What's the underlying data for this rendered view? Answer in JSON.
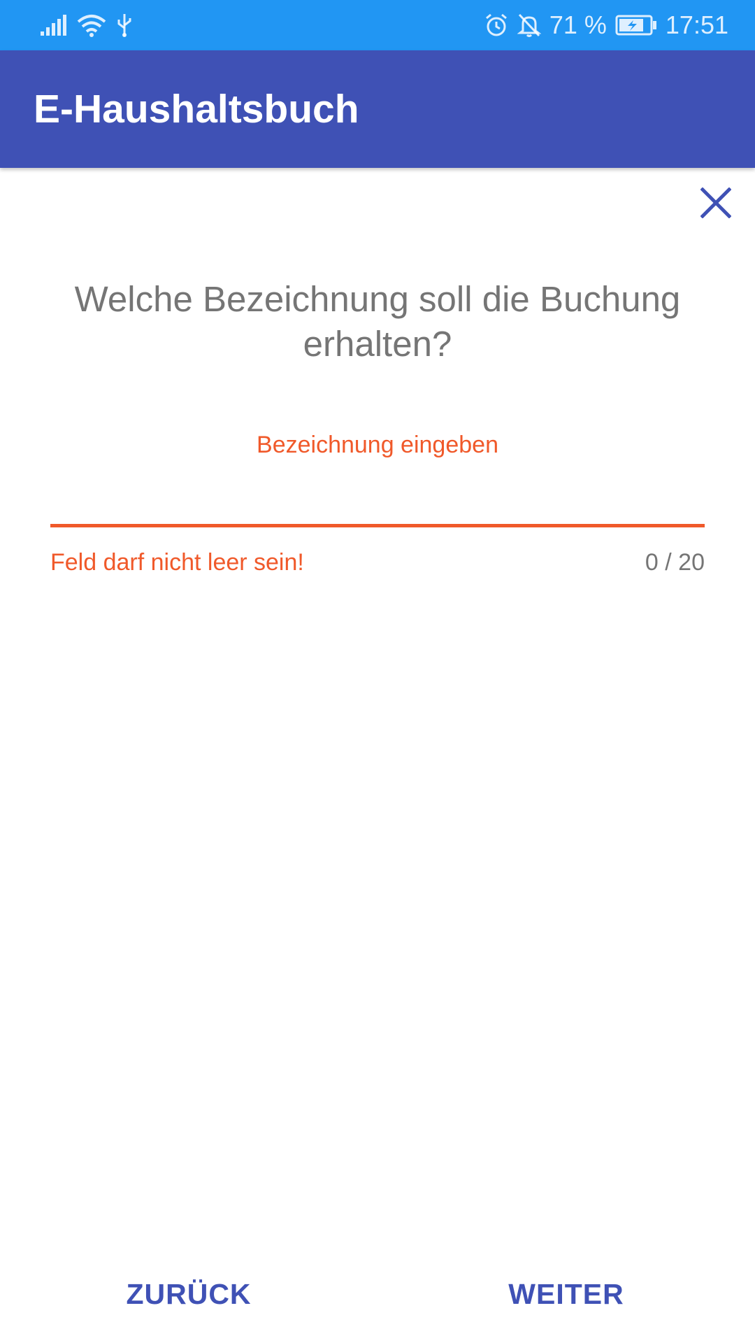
{
  "status_bar": {
    "battery_percent": "71 %",
    "time": "17:51",
    "icons": [
      "signal-icon",
      "wifi-icon",
      "usb-icon",
      "alarm-icon",
      "notifications-off-icon",
      "battery-charging-icon"
    ],
    "background_color": "#2196F3"
  },
  "app_bar": {
    "title": "E-Haushaltsbuch",
    "background_color": "#3F51B5"
  },
  "dialog": {
    "close_icon": "close-icon",
    "question": "Welche Bezeichnung soll die Buchung erhalten?",
    "input": {
      "hint": "Bezeichnung eingeben",
      "value": "",
      "error": "Feld darf nicht leer sein!",
      "counter": "0 / 20"
    },
    "error_color": "#F0592A"
  },
  "buttons": {
    "back_label": "ZURÜCK",
    "next_label": "WEITER"
  }
}
